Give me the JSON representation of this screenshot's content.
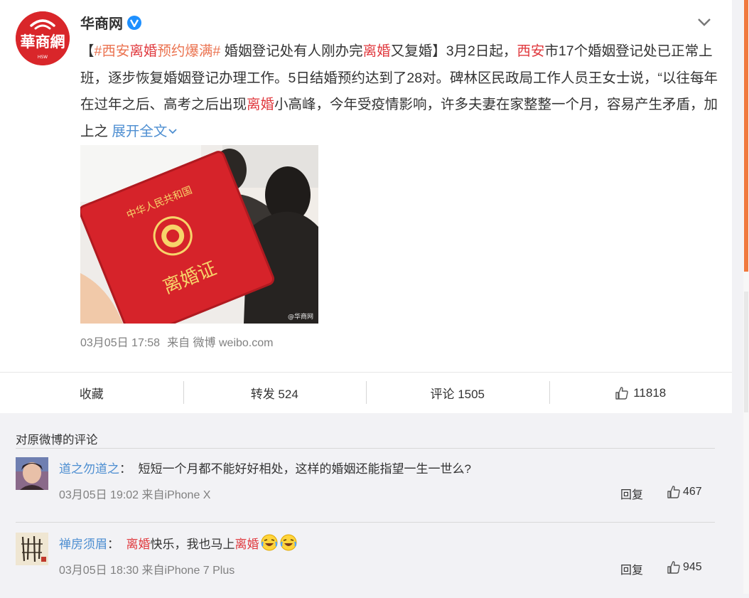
{
  "post": {
    "author": "华商网",
    "avatar_label": "華商網",
    "verified_icon": "verified-v-icon",
    "menu_icon": "chevron-down-icon",
    "content_parts": [
      {
        "text": "【",
        "style": "normal"
      },
      {
        "text": "#西安",
        "style": "topic"
      },
      {
        "text": "离婚",
        "style": "hot"
      },
      {
        "text": "预约爆满#",
        "style": "topic"
      },
      {
        "text": " 婚姻登记处有人刚办完",
        "style": "normal"
      },
      {
        "text": "离婚",
        "style": "hot"
      },
      {
        "text": "又复婚】3月2日起，",
        "style": "normal"
      },
      {
        "text": "西安",
        "style": "hot"
      },
      {
        "text": "市17个婚姻登记处已正常上班，逐步恢复婚姻登记办理工作。5日结婚预约达到了28对。碑林区民政局工作人员王女士说，“以往每年在过年之后、高考之后出现",
        "style": "normal"
      },
      {
        "text": "离婚",
        "style": "hot"
      },
      {
        "text": "小高峰，今年受疫情影响，许多夫妻在家整整一个月，容易产生矛盾，加上之 ",
        "style": "normal"
      }
    ],
    "expand_label": "展开全文",
    "image": {
      "book_title_top": "中华人民共和国",
      "book_title": "离婚证",
      "watermark": "@华商网"
    },
    "timestamp": "03月05日 17:58",
    "source": "来自 微博 weibo.com"
  },
  "actions": {
    "favorite": "收藏",
    "repost": "转发 524",
    "comment": "评论 1505",
    "like_count": "11818"
  },
  "comments_section": {
    "title": "对原微博的评论",
    "items": [
      {
        "user": "道之勿道之",
        "text": "短短一个月都不能好好相处，这样的婚姻还能指望一生一世么?",
        "time": "03月05日 19:02 来自iPhone X",
        "reply": "回复",
        "likes": "467"
      },
      {
        "user": "禅房须眉",
        "text_parts": [
          {
            "text": "离婚",
            "style": "hot"
          },
          {
            "text": "快乐，我也马上",
            "style": "normal"
          },
          {
            "text": "离婚",
            "style": "hot"
          }
        ],
        "emoji_icon": "laugh-cry-emoji-icon",
        "time": "03月05日 18:30 来自iPhone 7 Plus",
        "reply": "回复",
        "likes": "945"
      }
    ]
  },
  "colors": {
    "topic": "#eb7350",
    "keyword": "#e0393e",
    "link": "#4d8ed1",
    "scroll_accent": "#f0793e"
  }
}
